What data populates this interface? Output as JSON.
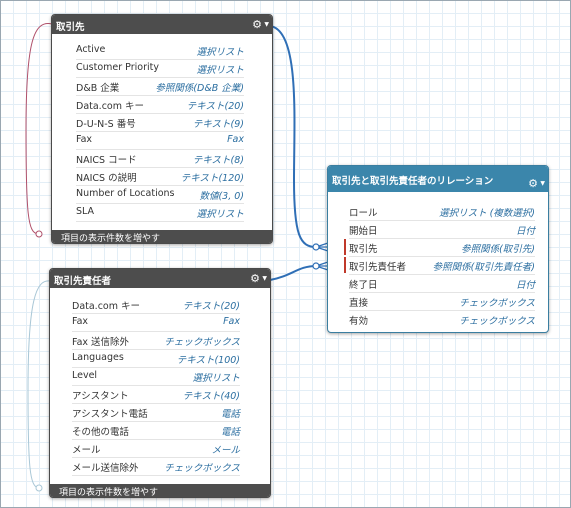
{
  "account": {
    "title": "取引先",
    "fields": [
      {
        "name": "Active",
        "type": "選択リスト"
      },
      {
        "name": "Customer Priority",
        "type": "選択リスト"
      },
      {
        "name": "D&B 企業",
        "type": "参照関係(D&B 企業)"
      },
      {
        "name": "Data.com キー",
        "type": "テキスト(20)"
      },
      {
        "name": "D-U-N-S 番号",
        "type": "テキスト(9)"
      },
      {
        "name": "Fax",
        "type": "Fax"
      },
      {
        "name": "NAICS コード",
        "type": "テキスト(8)"
      },
      {
        "name": "NAICS の説明",
        "type": "テキスト(120)"
      },
      {
        "name": "Number of Locations",
        "type": "数値(3, 0)"
      },
      {
        "name": "SLA",
        "type": "選択リスト"
      }
    ],
    "footer": "項目の表示件数を増やす"
  },
  "contact": {
    "title": "取引先責任者",
    "fields": [
      {
        "name": "Data.com キー",
        "type": "テキスト(20)"
      },
      {
        "name": "Fax",
        "type": "Fax"
      },
      {
        "name": "Fax 送信除外",
        "type": "チェックボックス"
      },
      {
        "name": "Languages",
        "type": "テキスト(100)"
      },
      {
        "name": "Level",
        "type": "選択リスト"
      },
      {
        "name": "アシスタント",
        "type": "テキスト(40)"
      },
      {
        "name": "アシスタント電話",
        "type": "電話"
      },
      {
        "name": "その他の電話",
        "type": "電話"
      },
      {
        "name": "メール",
        "type": "メール"
      },
      {
        "name": "メール送信除外",
        "type": "チェックボックス"
      }
    ],
    "footer": "項目の表示件数を増やす"
  },
  "relation": {
    "title": "取引先と取引先責任者のリレーション",
    "fields": [
      {
        "name": "ロール",
        "type": "選択リスト (複数選択)",
        "rel": false
      },
      {
        "name": "開始日",
        "type": "日付",
        "rel": false
      },
      {
        "name": "取引先",
        "type": "参照関係(取引先)",
        "rel": true
      },
      {
        "name": "取引先責任者",
        "type": "参照関係(取引先責任者)",
        "rel": true
      },
      {
        "name": "終了日",
        "type": "日付",
        "rel": false
      },
      {
        "name": "直接",
        "type": "チェックボックス",
        "rel": false
      },
      {
        "name": "有効",
        "type": "チェックボックス",
        "rel": false
      }
    ]
  },
  "icons": {
    "gear": "gear-icon",
    "caret": "caret-down-icon"
  },
  "colors": {
    "link_lookup": "#2f6fb6",
    "link_account_self": "#b0506a",
    "link_contact_self": "#a9c7d6",
    "relation_header": "#3b86ab",
    "object_header": "#4d4d4d",
    "field_type": "#2b6ea0"
  }
}
